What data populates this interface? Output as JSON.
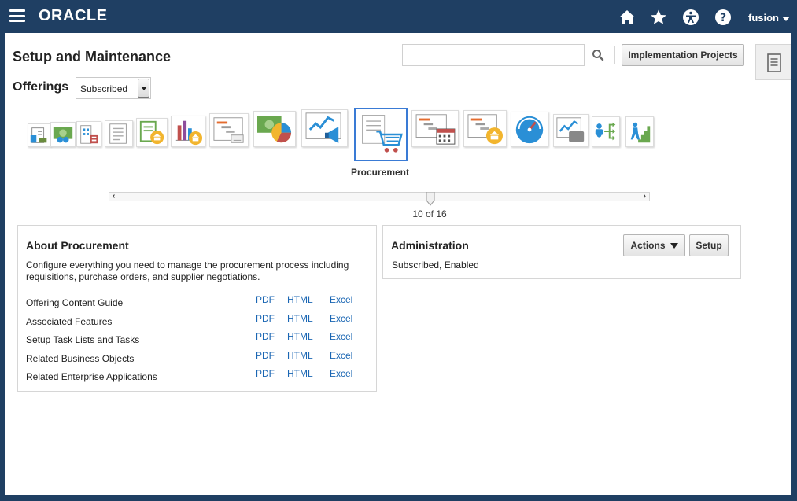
{
  "header": {
    "logo": "ORACLE",
    "user": "fusion",
    "icons": [
      "hamburger-icon",
      "home-icon",
      "star-icon",
      "accessibility-icon",
      "help-icon"
    ]
  },
  "page": {
    "title": "Setup and Maintenance",
    "search_value": "",
    "search_placeholder": "",
    "implementation_projects_label": "Implementation Projects"
  },
  "offerings": {
    "label": "Offerings",
    "selected": "Subscribed"
  },
  "carousel": {
    "selected_name": "Procurement",
    "current_index": 10,
    "total": 16,
    "position_text": "10 of 16",
    "tiles": [
      "financials-icon",
      "payroll-icon",
      "facilities-icon",
      "documents-icon",
      "banking-icon",
      "analytics-icon",
      "project-tasks-icon",
      "sales-chart-icon",
      "marketing-icon",
      "procurement-icon",
      "scheduling-icon",
      "banking-tasks-icon",
      "gauge-icon",
      "monitoring-icon",
      "workforce-icon",
      "career-icon"
    ]
  },
  "about": {
    "title": "About Procurement",
    "description": "Configure everything you need to manage the procurement process including requisitions, purchase orders, and supplier negotiations.",
    "rows": [
      {
        "label": "Offering Content Guide",
        "pdf": "PDF",
        "html": "HTML",
        "excel": "Excel"
      },
      {
        "label": "Associated Features",
        "pdf": "PDF",
        "html": "HTML",
        "excel": "Excel"
      },
      {
        "label": "Setup Task Lists and Tasks",
        "pdf": "PDF",
        "html": "HTML",
        "excel": "Excel"
      },
      {
        "label": "Related Business Objects",
        "pdf": "PDF",
        "html": "HTML",
        "excel": "Excel"
      },
      {
        "label": "Related Enterprise Applications",
        "pdf": "PDF",
        "html": "HTML",
        "excel": "Excel"
      }
    ]
  },
  "administration": {
    "title": "Administration",
    "status": "Subscribed, Enabled",
    "actions_label": "Actions",
    "setup_label": "Setup"
  },
  "colors": {
    "header_bg": "#1f3f63",
    "link": "#1a66b3",
    "selected_border": "#3a7bd5"
  }
}
